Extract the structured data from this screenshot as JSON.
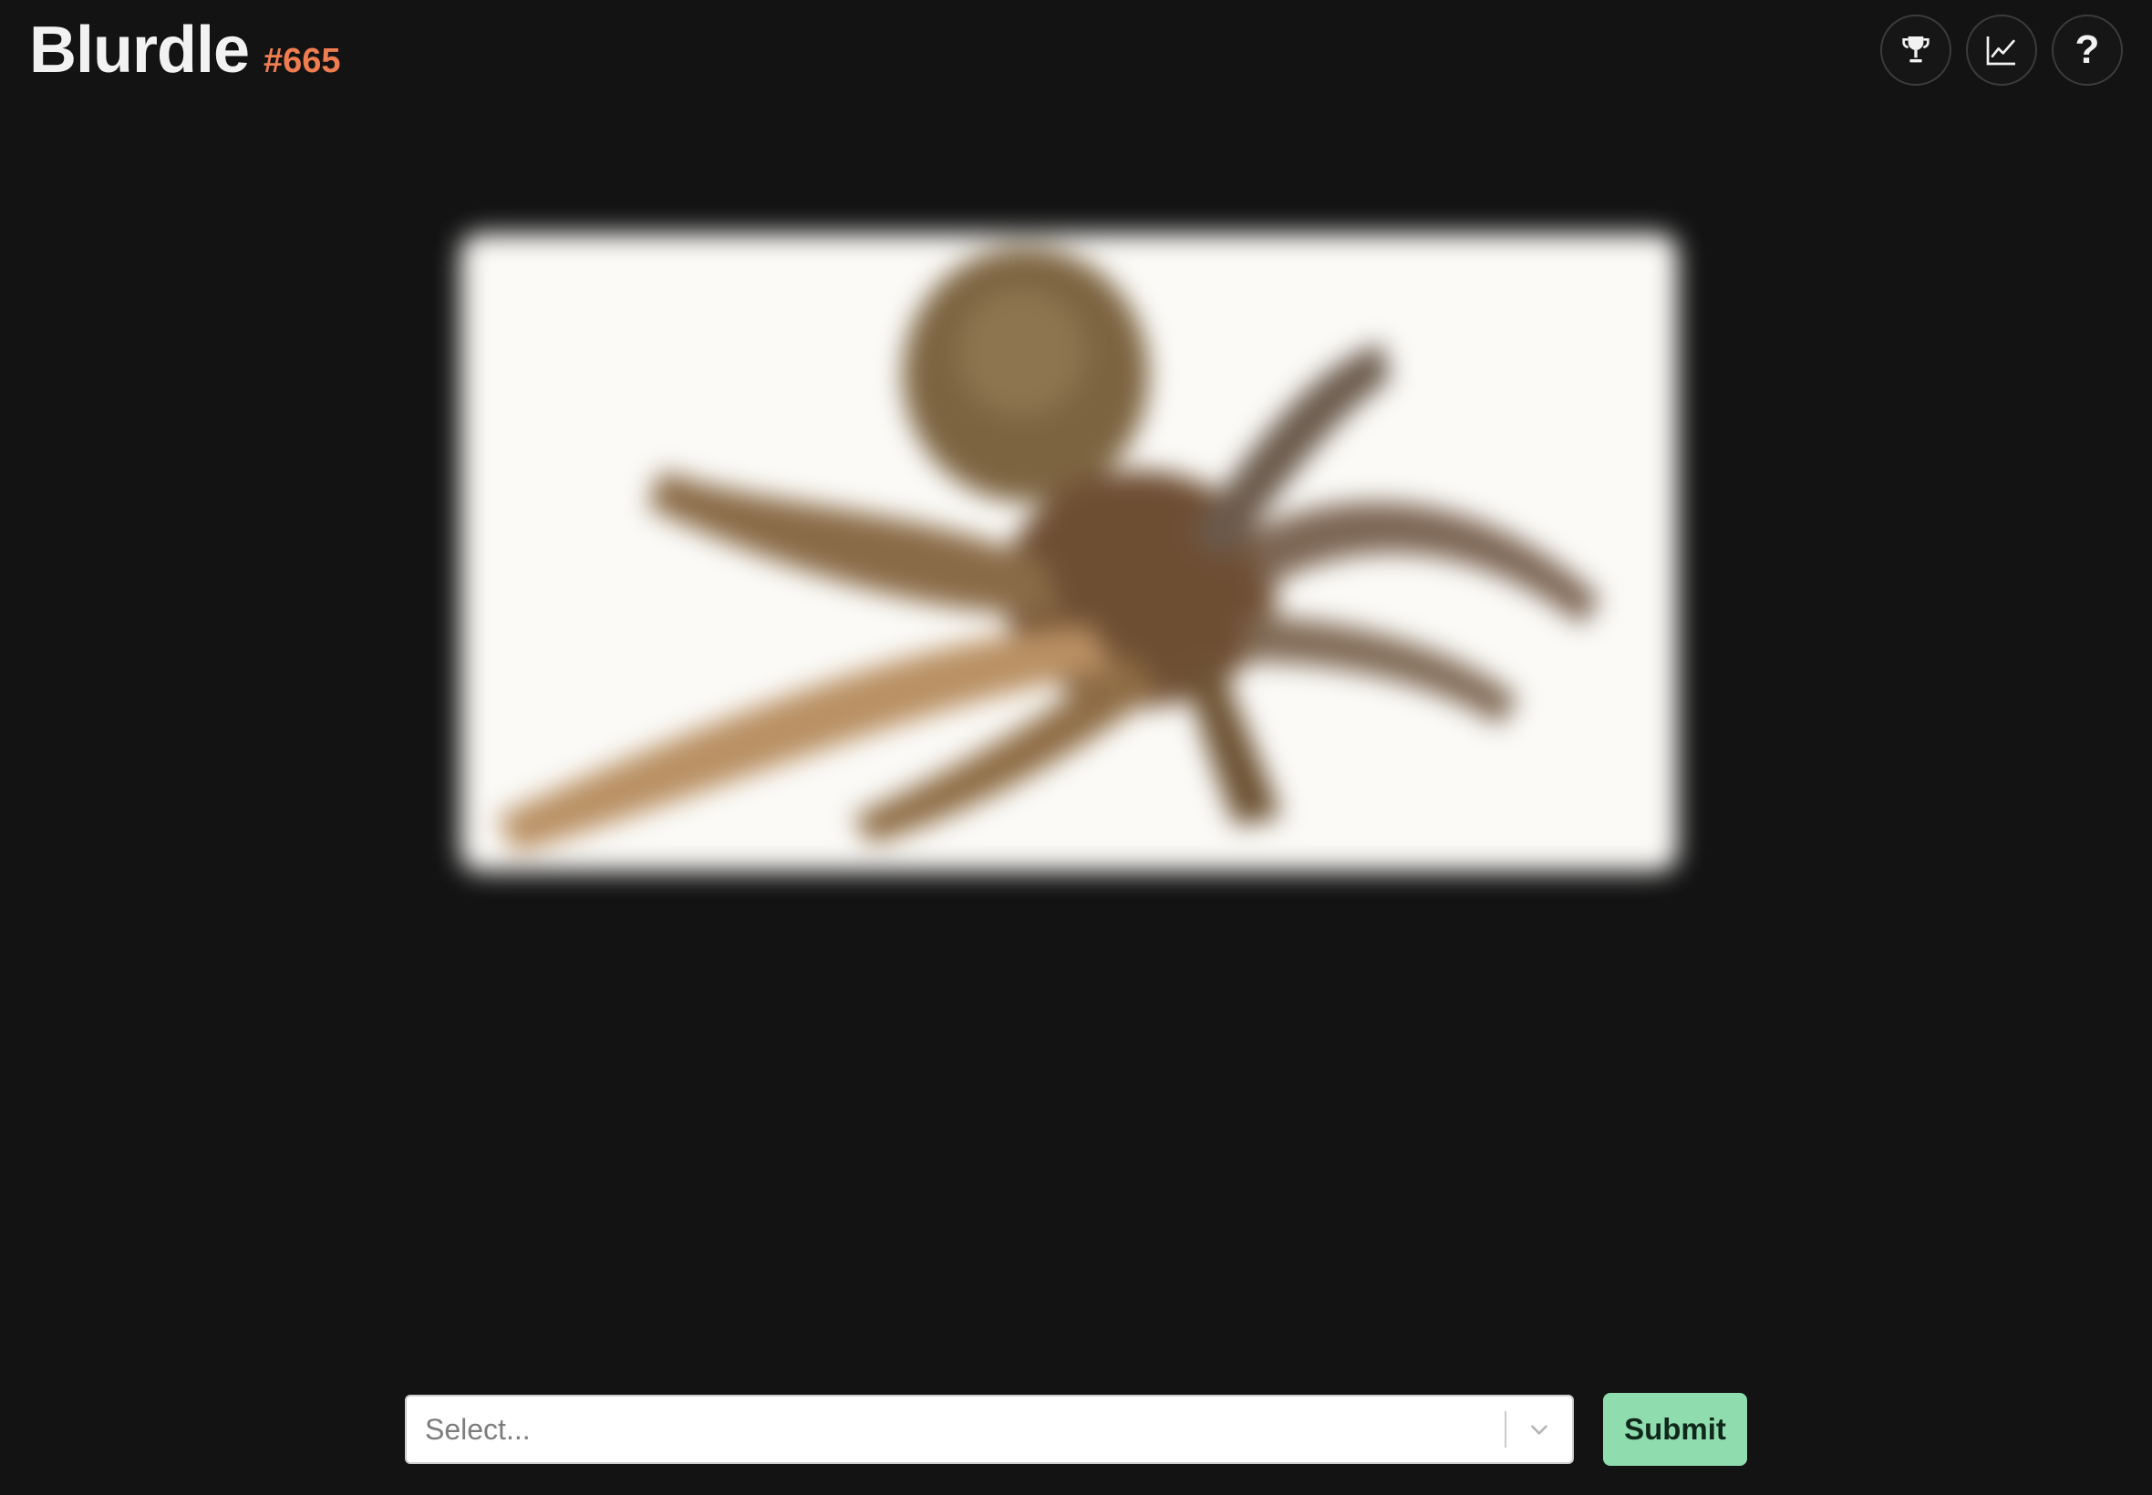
{
  "header": {
    "title": "Blurdle",
    "puzzle_number": "#665",
    "buttons": [
      {
        "name": "leaderboard",
        "icon": "trophy-icon"
      },
      {
        "name": "stats",
        "icon": "line-chart-icon"
      },
      {
        "name": "help",
        "icon": "question-icon",
        "glyph": "?"
      }
    ]
  },
  "puzzle_image": {
    "subject_icon": "octopus-blurred-image"
  },
  "guess": {
    "select_placeholder": "Select...",
    "submit_label": "Submit"
  },
  "colors": {
    "background": "#131313",
    "accent_number": "#ef7d50",
    "submit_bg": "#8fdcaf"
  }
}
